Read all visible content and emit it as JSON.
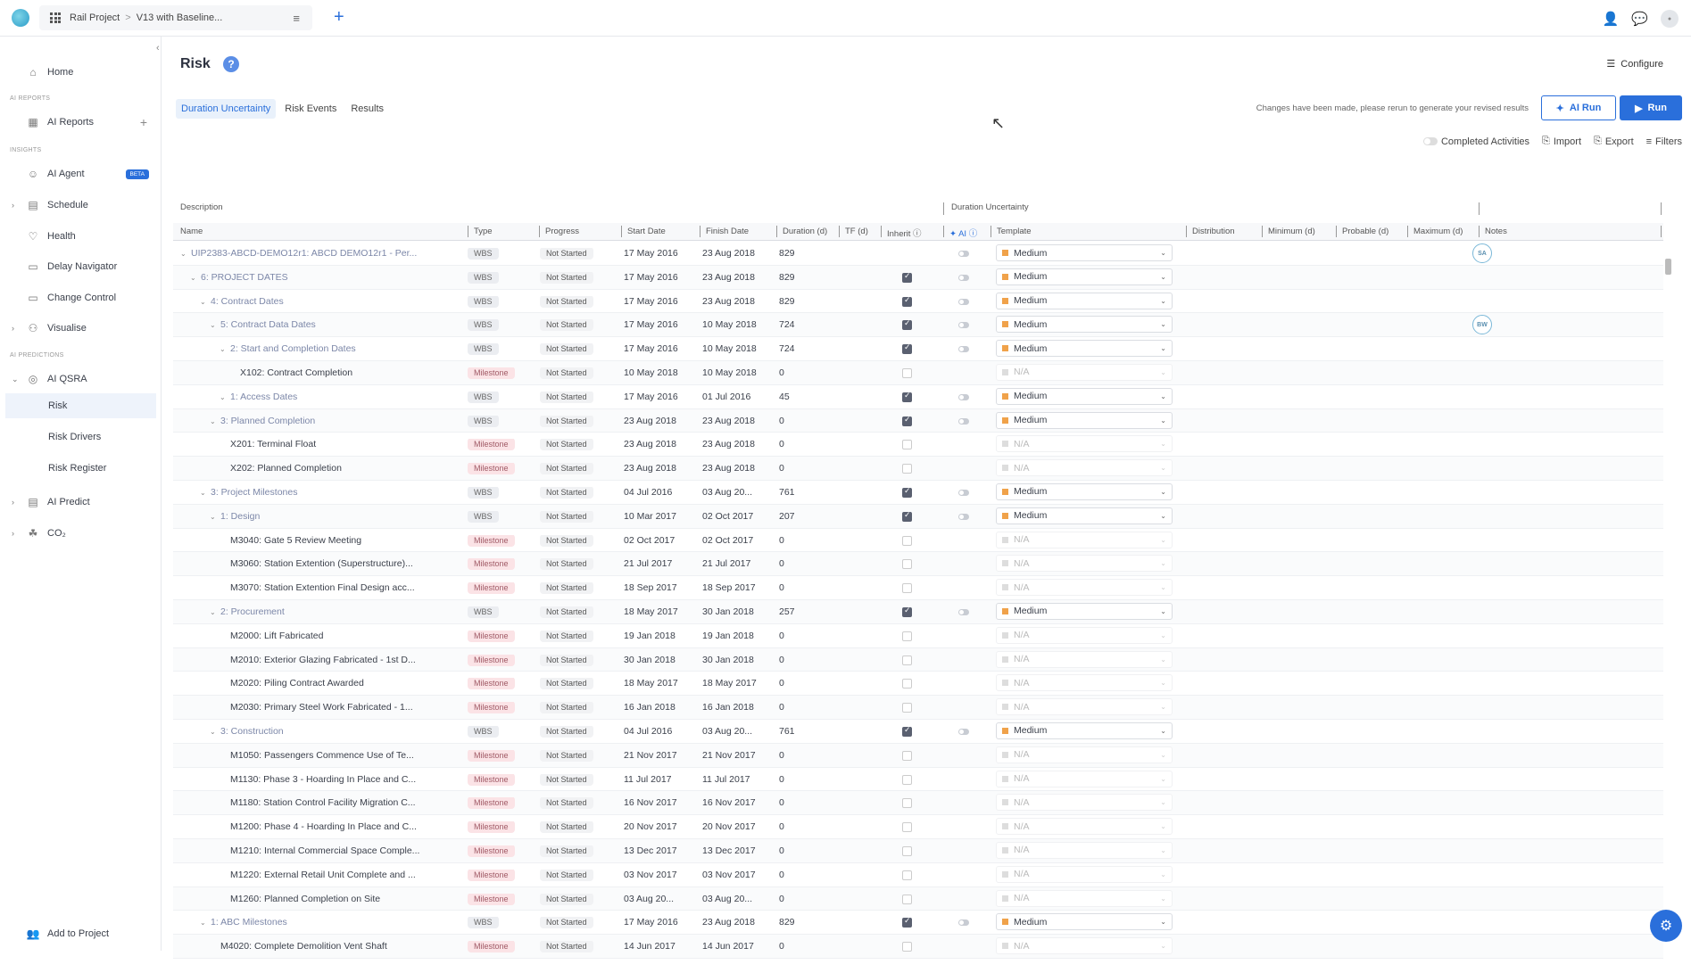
{
  "topbar": {
    "project": "Rail Project",
    "separator": ">",
    "version": "V13 with Baseline..."
  },
  "sidebar": {
    "home": "Home",
    "sec_ai_reports": "AI REPORTS",
    "ai_reports": "AI Reports",
    "sec_insights": "INSIGHTS",
    "ai_agent": "AI Agent",
    "beta": "BETA",
    "schedule": "Schedule",
    "health": "Health",
    "delay_navigator": "Delay Navigator",
    "change_control": "Change Control",
    "visualise": "Visualise",
    "sec_ai_predictions": "AI PREDICTIONS",
    "ai_qsra": "AI QSRA",
    "risk": "Risk",
    "risk_drivers": "Risk Drivers",
    "risk_register": "Risk Register",
    "ai_predict": "AI Predict",
    "co2": "CO₂",
    "add_to_project": "Add to Project"
  },
  "header": {
    "title": "Risk",
    "help": "?",
    "configure": "Configure"
  },
  "tabs": [
    "Duration Uncertainty",
    "Risk Events",
    "Results"
  ],
  "notice": "Changes have been made, please rerun to generate your revised results",
  "buttons": {
    "ai_run": "AI Run",
    "run": "Run"
  },
  "toolbar": {
    "completed": "Completed Activities",
    "import": "Import",
    "export": "Export",
    "filters": "Filters"
  },
  "group_headers": {
    "description": "Description",
    "duration_uncertainty": "Duration Uncertainty"
  },
  "columns": {
    "name": "Name",
    "type": "Type",
    "progress": "Progress",
    "start": "Start Date",
    "finish": "Finish Date",
    "duration": "Duration (d)",
    "tf": "TF (d)",
    "inherit": "Inherit",
    "ai": "AI",
    "template": "Template",
    "distribution": "Distribution",
    "minimum": "Minimum (d)",
    "probable": "Probable (d)",
    "maximum": "Maximum (d)",
    "notes": "Notes"
  },
  "rows": [
    {
      "name": "UIP2383-ABCD-DEMO12r1: ABCD DEMO12r1 - Per...",
      "level": 0,
      "wbs": true,
      "type": "WBS",
      "progress": "Not Started",
      "start": "17 May 2016",
      "finish": "23 Aug 2018",
      "duration": "829",
      "inherit": null,
      "template": "Medium",
      "note": "SA"
    },
    {
      "name": "6: PROJECT DATES",
      "level": 1,
      "wbs": true,
      "type": "WBS",
      "progress": "Not Started",
      "start": "17 May 2016",
      "finish": "23 Aug 2018",
      "duration": "829",
      "inherit": true,
      "template": "Medium",
      "note": ""
    },
    {
      "name": "4: Contract Dates",
      "level": 2,
      "wbs": true,
      "type": "WBS",
      "progress": "Not Started",
      "start": "17 May 2016",
      "finish": "23 Aug 2018",
      "duration": "829",
      "inherit": true,
      "template": "Medium",
      "note": ""
    },
    {
      "name": "5: Contract Data Dates",
      "level": 3,
      "wbs": true,
      "type": "WBS",
      "progress": "Not Started",
      "start": "17 May 2016",
      "finish": "10 May 2018",
      "duration": "724",
      "inherit": true,
      "template": "Medium",
      "note": "BW"
    },
    {
      "name": "2: Start and Completion Dates",
      "level": 4,
      "wbs": true,
      "type": "WBS",
      "progress": "Not Started",
      "start": "17 May 2016",
      "finish": "10 May 2018",
      "duration": "724",
      "inherit": true,
      "template": "Medium",
      "note": ""
    },
    {
      "name": "X102: Contract Completion",
      "level": 5,
      "wbs": false,
      "type": "Milestone",
      "progress": "Not Started",
      "start": "10 May 2018",
      "finish": "10 May 2018",
      "duration": "0",
      "inherit": false,
      "template": "N/A",
      "note": ""
    },
    {
      "name": "1: Access Dates",
      "level": 4,
      "wbs": true,
      "type": "WBS",
      "progress": "Not Started",
      "start": "17 May 2016",
      "finish": "01 Jul 2016",
      "duration": "45",
      "inherit": true,
      "template": "Medium",
      "note": ""
    },
    {
      "name": "3: Planned Completion",
      "level": 3,
      "wbs": true,
      "type": "WBS",
      "progress": "Not Started",
      "start": "23 Aug 2018",
      "finish": "23 Aug 2018",
      "duration": "0",
      "inherit": true,
      "template": "Medium",
      "note": ""
    },
    {
      "name": "X201: Terminal Float",
      "level": 4,
      "wbs": false,
      "type": "Milestone",
      "progress": "Not Started",
      "start": "23 Aug 2018",
      "finish": "23 Aug 2018",
      "duration": "0",
      "inherit": false,
      "template": "N/A",
      "note": ""
    },
    {
      "name": "X202: Planned Completion",
      "level": 4,
      "wbs": false,
      "type": "Milestone",
      "progress": "Not Started",
      "start": "23 Aug 2018",
      "finish": "23 Aug 2018",
      "duration": "0",
      "inherit": false,
      "template": "N/A",
      "note": ""
    },
    {
      "name": "3: Project Milestones",
      "level": 2,
      "wbs": true,
      "type": "WBS",
      "progress": "Not Started",
      "start": "04 Jul 2016",
      "finish": "03 Aug 20...",
      "duration": "761",
      "inherit": true,
      "template": "Medium",
      "note": ""
    },
    {
      "name": "1: Design",
      "level": 3,
      "wbs": true,
      "type": "WBS",
      "progress": "Not Started",
      "start": "10 Mar 2017",
      "finish": "02 Oct 2017",
      "duration": "207",
      "inherit": true,
      "template": "Medium",
      "note": ""
    },
    {
      "name": "M3040: Gate 5 Review Meeting",
      "level": 4,
      "wbs": false,
      "type": "Milestone",
      "progress": "Not Started",
      "start": "02 Oct 2017",
      "finish": "02 Oct 2017",
      "duration": "0",
      "inherit": false,
      "template": "N/A",
      "note": ""
    },
    {
      "name": "M3060: Station Extention (Superstructure)...",
      "level": 4,
      "wbs": false,
      "type": "Milestone",
      "progress": "Not Started",
      "start": "21 Jul 2017",
      "finish": "21 Jul 2017",
      "duration": "0",
      "inherit": false,
      "template": "N/A",
      "note": ""
    },
    {
      "name": "M3070: Station Extention Final Design acc...",
      "level": 4,
      "wbs": false,
      "type": "Milestone",
      "progress": "Not Started",
      "start": "18 Sep 2017",
      "finish": "18 Sep 2017",
      "duration": "0",
      "inherit": false,
      "template": "N/A",
      "note": ""
    },
    {
      "name": "2: Procurement",
      "level": 3,
      "wbs": true,
      "type": "WBS",
      "progress": "Not Started",
      "start": "18 May 2017",
      "finish": "30 Jan 2018",
      "duration": "257",
      "inherit": true,
      "template": "Medium",
      "note": ""
    },
    {
      "name": "M2000: Lift Fabricated",
      "level": 4,
      "wbs": false,
      "type": "Milestone",
      "progress": "Not Started",
      "start": "19 Jan 2018",
      "finish": "19 Jan 2018",
      "duration": "0",
      "inherit": false,
      "template": "N/A",
      "note": ""
    },
    {
      "name": "M2010: Exterior Glazing Fabricated - 1st D...",
      "level": 4,
      "wbs": false,
      "type": "Milestone",
      "progress": "Not Started",
      "start": "30 Jan 2018",
      "finish": "30 Jan 2018",
      "duration": "0",
      "inherit": false,
      "template": "N/A",
      "note": ""
    },
    {
      "name": "M2020: Piling Contract Awarded",
      "level": 4,
      "wbs": false,
      "type": "Milestone",
      "progress": "Not Started",
      "start": "18 May 2017",
      "finish": "18 May 2017",
      "duration": "0",
      "inherit": false,
      "template": "N/A",
      "note": ""
    },
    {
      "name": "M2030: Primary Steel Work Fabricated - 1...",
      "level": 4,
      "wbs": false,
      "type": "Milestone",
      "progress": "Not Started",
      "start": "16 Jan 2018",
      "finish": "16 Jan 2018",
      "duration": "0",
      "inherit": false,
      "template": "N/A",
      "note": ""
    },
    {
      "name": "3: Construction",
      "level": 3,
      "wbs": true,
      "type": "WBS",
      "progress": "Not Started",
      "start": "04 Jul 2016",
      "finish": "03 Aug 20...",
      "duration": "761",
      "inherit": true,
      "template": "Medium",
      "note": ""
    },
    {
      "name": "M1050: Passengers Commence Use of Te...",
      "level": 4,
      "wbs": false,
      "type": "Milestone",
      "progress": "Not Started",
      "start": "21 Nov 2017",
      "finish": "21 Nov 2017",
      "duration": "0",
      "inherit": false,
      "template": "N/A",
      "note": ""
    },
    {
      "name": "M1130: Phase 3 - Hoarding In Place and C...",
      "level": 4,
      "wbs": false,
      "type": "Milestone",
      "progress": "Not Started",
      "start": "11 Jul 2017",
      "finish": "11 Jul 2017",
      "duration": "0",
      "inherit": false,
      "template": "N/A",
      "note": ""
    },
    {
      "name": "M1180: Station Control Facility Migration C...",
      "level": 4,
      "wbs": false,
      "type": "Milestone",
      "progress": "Not Started",
      "start": "16 Nov 2017",
      "finish": "16 Nov 2017",
      "duration": "0",
      "inherit": false,
      "template": "N/A",
      "note": ""
    },
    {
      "name": "M1200: Phase 4 - Hoarding In Place and C...",
      "level": 4,
      "wbs": false,
      "type": "Milestone",
      "progress": "Not Started",
      "start": "20 Nov 2017",
      "finish": "20 Nov 2017",
      "duration": "0",
      "inherit": false,
      "template": "N/A",
      "note": ""
    },
    {
      "name": "M1210: Internal Commercial Space Comple...",
      "level": 4,
      "wbs": false,
      "type": "Milestone",
      "progress": "Not Started",
      "start": "13 Dec 2017",
      "finish": "13 Dec 2017",
      "duration": "0",
      "inherit": false,
      "template": "N/A",
      "note": ""
    },
    {
      "name": "M1220: External Retail Unit Complete and ...",
      "level": 4,
      "wbs": false,
      "type": "Milestone",
      "progress": "Not Started",
      "start": "03 Nov 2017",
      "finish": "03 Nov 2017",
      "duration": "0",
      "inherit": false,
      "template": "N/A",
      "note": ""
    },
    {
      "name": "M1260: Planned Completion on Site",
      "level": 4,
      "wbs": false,
      "type": "Milestone",
      "progress": "Not Started",
      "start": "03 Aug 20...",
      "finish": "03 Aug 20...",
      "duration": "0",
      "inherit": false,
      "template": "N/A",
      "note": ""
    },
    {
      "name": "1: ABC Milestones",
      "level": 2,
      "wbs": true,
      "type": "WBS",
      "progress": "Not Started",
      "start": "17 May 2016",
      "finish": "23 Aug 2018",
      "duration": "829",
      "inherit": true,
      "template": "Medium",
      "note": ""
    },
    {
      "name": "M4020: Complete Demolition Vent Shaft",
      "level": 3,
      "wbs": false,
      "type": "Milestone",
      "progress": "Not Started",
      "start": "14 Jun 2017",
      "finish": "14 Jun 2017",
      "duration": "0",
      "inherit": false,
      "template": "N/A",
      "note": ""
    }
  ],
  "colors": {
    "accent": "#2a6fdb",
    "template_medium": "#f0a24a",
    "milestone_pill": "#fbe3e6"
  }
}
